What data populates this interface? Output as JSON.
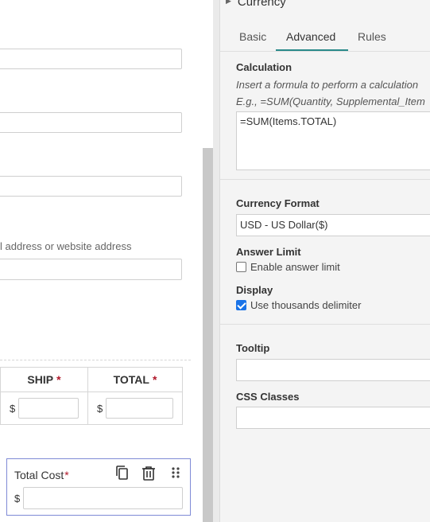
{
  "canvas": {
    "hint_text": "l address or website address",
    "columns": [
      {
        "label": "SHIP",
        "required": "*",
        "currency": "$"
      },
      {
        "label": "TOTAL",
        "required": "*",
        "currency": "$"
      }
    ],
    "total_cost": {
      "label": "Total Cost",
      "required": "*",
      "currency": "$"
    },
    "icons": {
      "copy": "copy-icon",
      "delete": "trash-icon",
      "drag": "drag-handle-icon"
    }
  },
  "panel": {
    "title": "Currency",
    "tabs": [
      "Basic",
      "Advanced",
      "Rules"
    ],
    "active_tab": "Advanced",
    "calculation": {
      "label": "Calculation",
      "help_line1": "Insert a formula to perform a calculation",
      "help_line2": "E.g., =SUM(Quantity, Supplemental_Item",
      "value": "=SUM(Items.TOTAL)"
    },
    "currency_format": {
      "label": "Currency Format",
      "value": "USD - US Dollar($)"
    },
    "answer_limit": {
      "label": "Answer Limit",
      "option": "Enable answer limit",
      "checked": false
    },
    "display": {
      "label": "Display",
      "option": "Use thousands delimiter",
      "checked": true
    },
    "tooltip": {
      "label": "Tooltip",
      "value": ""
    },
    "css_classes": {
      "label": "CSS Classes",
      "value": ""
    }
  },
  "colors": {
    "accent": "#2a8a8a",
    "required": "#b0182a",
    "selection_border": "#7f8ad6",
    "checkbox": "#1a73e8"
  }
}
